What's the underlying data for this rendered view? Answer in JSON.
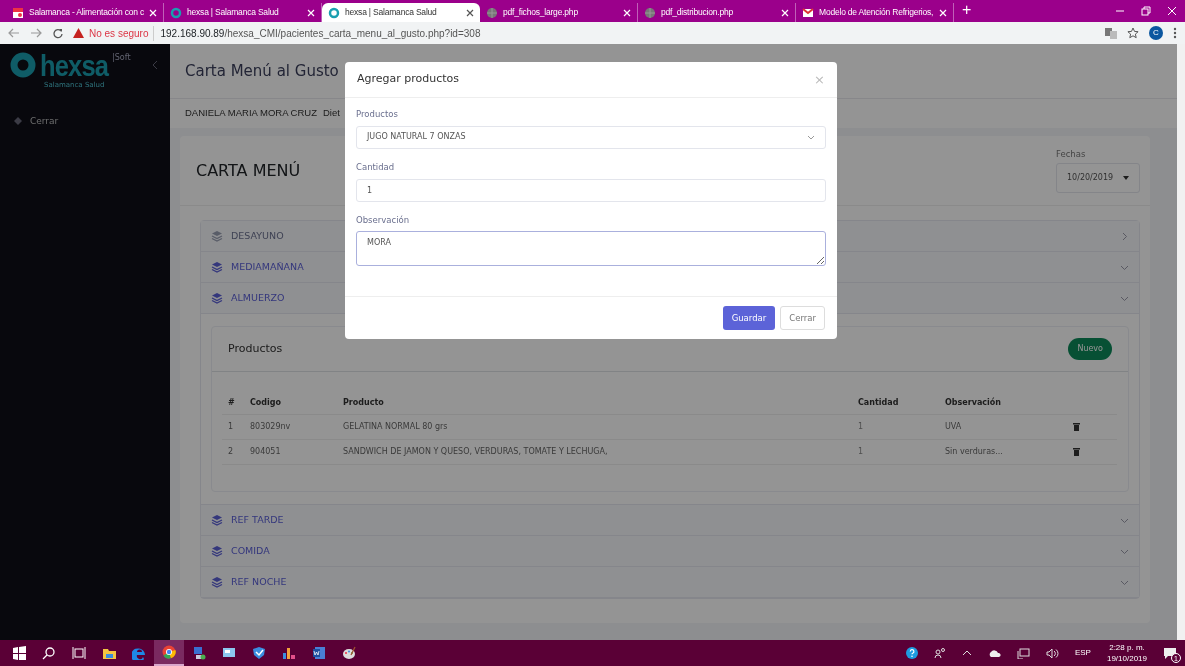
{
  "browser": {
    "tabs": [
      {
        "title": "Salamanca - Alimentación con c",
        "selected": false
      },
      {
        "title": "hexsa | Salamanca Salud",
        "selected": false
      },
      {
        "title": "hexsa | Salamanca Salud",
        "selected": true
      },
      {
        "title": "pdf_fichos_large.php",
        "selected": false
      },
      {
        "title": "pdf_distribucion.php",
        "selected": false
      },
      {
        "title": "Modelo de Atención Refrigerios,",
        "selected": false
      }
    ],
    "new_tab": "+",
    "security": "No es seguro",
    "url_host": "192.168.90.89",
    "url_path": "/hexsa_CMI/pacientes_carta_menu_al_gusto.php?id=308",
    "profile": "C"
  },
  "sidebar": {
    "logo": "hexsa",
    "logo_tag": "|Soft",
    "logo_sub": "Salamanca Salud",
    "items": [
      {
        "label": "Cerrar"
      }
    ]
  },
  "page": {
    "title": "Carta Menú al Gusto",
    "patient": "DANIELA MARIA MORA CRUZ",
    "patient_extra": "Diet",
    "card_title": "CARTA MENÚ",
    "date_label": "Fechas",
    "date": "10/20/2019",
    "meals": [
      {
        "label": "DESAYUNO",
        "expanded": false,
        "enabled": false
      },
      {
        "label": "MEDIAMAÑANA",
        "expanded": true,
        "enabled": true
      },
      {
        "label": "ALMUERZO",
        "expanded": true,
        "enabled": true,
        "products": {
          "title": "Productos",
          "new_button": "Nuevo",
          "columns": [
            "#",
            "Codigo",
            "Producto",
            "Cantidad",
            "Observación"
          ],
          "rows": [
            [
              "1",
              "803029nv",
              "GELATINA NORMAL 80 grs",
              "1",
              "UVA"
            ],
            [
              "2",
              "904051",
              "SANDWICH DE JAMON Y QUESO, VERDURAS, TOMATE Y LECHUGA,",
              "1",
              "Sin verduras..."
            ]
          ]
        }
      },
      {
        "label": "REF TARDE",
        "expanded": true,
        "enabled": true
      },
      {
        "label": "COMIDA",
        "expanded": true,
        "enabled": true
      },
      {
        "label": "REF NOCHE",
        "expanded": true,
        "enabled": true
      }
    ]
  },
  "modal": {
    "title": "Agregar productos",
    "close": "×",
    "fields": [
      {
        "label": "Productos",
        "kind": "select",
        "value": "JUGO NATURAL 7 ONZAS"
      },
      {
        "label": "Cantidad",
        "kind": "input",
        "value": "1"
      },
      {
        "label": "Observación",
        "kind": "textarea",
        "value": "MORA"
      }
    ],
    "buttons": [
      {
        "label": "Guardar",
        "kind": "primary"
      },
      {
        "label": "Cerrar",
        "kind": "secondary"
      }
    ]
  },
  "taskbar": {
    "apps": [
      {
        "selected": false
      },
      {
        "selected": false
      },
      {
        "selected": false
      },
      {
        "selected": false
      },
      {
        "selected": false
      },
      {
        "selected": true
      },
      {
        "selected": false
      },
      {
        "selected": false
      },
      {
        "selected": false
      },
      {
        "selected": false
      },
      {
        "selected": false
      },
      {
        "selected": false
      }
    ],
    "language": "ESP",
    "time": "2:28 p. m.",
    "date": "19/10/2019",
    "notifications": "1"
  }
}
